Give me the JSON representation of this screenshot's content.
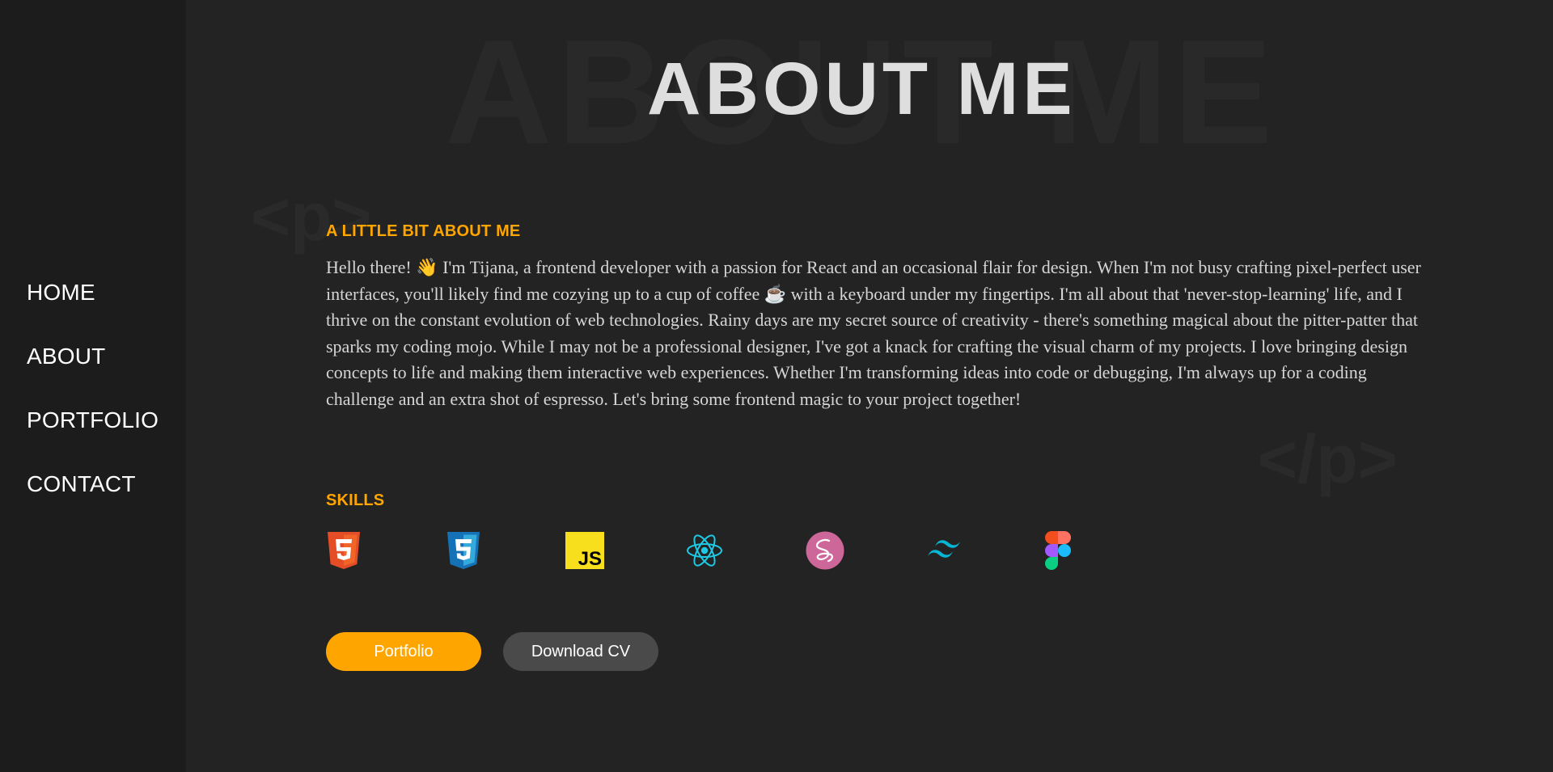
{
  "nav": {
    "items": [
      {
        "label": "HOME"
      },
      {
        "label": "ABOUT"
      },
      {
        "label": "PORTFOLIO"
      },
      {
        "label": "CONTACT"
      }
    ]
  },
  "page": {
    "background_title": "ABOUT ME",
    "title": "ABOUT ME",
    "deco_open": "<p>",
    "deco_close": "</p>"
  },
  "about": {
    "heading": "A LITTLE BIT ABOUT ME",
    "bio": "Hello there! 👋 I'm Tijana, a frontend developer with a passion for React and an occasional flair for design. When I'm not busy crafting pixel-perfect user interfaces, you'll likely find me cozying up to a cup of coffee ☕ with a keyboard under my fingertips. I'm all about that 'never-stop-learning' life, and I thrive on the constant evolution of web technologies. Rainy days are my secret source of creativity - there's something magical about the pitter-patter that sparks my coding mojo. While I may not be a professional designer, I've got a knack for crafting the visual charm of my projects. I love bringing design concepts to life and making them interactive web experiences. Whether I'm transforming ideas into code or debugging, I'm always up for a coding challenge and an extra shot of espresso. Let's bring some frontend magic to your project together!"
  },
  "skills": {
    "heading": "SKILLS",
    "icons": [
      "html5-icon",
      "css3-icon",
      "javascript-icon",
      "react-icon",
      "sass-icon",
      "tailwind-icon",
      "figma-icon"
    ]
  },
  "buttons": {
    "portfolio": "Portfolio",
    "download_cv": "Download CV"
  },
  "colors": {
    "accent": "#ffa500",
    "background": "#232323",
    "sidebar": "#1c1c1c",
    "secondary_button": "#4a4a4a"
  }
}
